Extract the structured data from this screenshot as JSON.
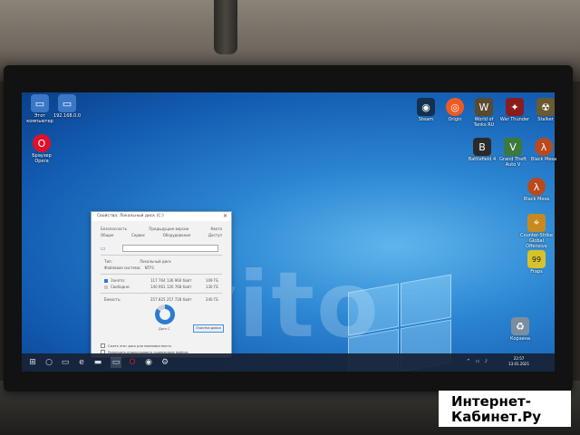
{
  "watermark": "Avito",
  "desktop_icons": [
    {
      "id": "this-pc",
      "label": "Этот компьютер",
      "color": "#3a77c4",
      "glyph": "▭"
    },
    {
      "id": "network",
      "label": "192.168.0.0",
      "color": "#3a77c4",
      "glyph": "▭"
    },
    {
      "id": "opera",
      "label": "Браузер Opera",
      "color": "#e0102a",
      "glyph": "O"
    },
    {
      "id": "steam",
      "label": "Steam",
      "color": "#14304f",
      "glyph": "◉"
    },
    {
      "id": "origin",
      "label": "Origin",
      "color": "#f05a22",
      "glyph": "◎"
    },
    {
      "id": "wot",
      "label": "World of Tanks RU",
      "color": "#5a4a2e",
      "glyph": "W"
    },
    {
      "id": "warthunder",
      "label": "War Thunder",
      "color": "#8a1c1c",
      "glyph": "✦"
    },
    {
      "id": "stalker",
      "label": "Stalker",
      "color": "#6a5a30",
      "glyph": "☢"
    },
    {
      "id": "battlefield",
      "label": "Battlefield 4",
      "color": "#2a2a2a",
      "glyph": "B"
    },
    {
      "id": "gta",
      "label": "Grand Theft Auto V",
      "color": "#3b7a3b",
      "glyph": "V"
    },
    {
      "id": "blackmesa1",
      "label": "Black Mesa",
      "color": "#b84a1e",
      "glyph": "λ"
    },
    {
      "id": "blackmesa2",
      "label": "Black Mesa",
      "color": "#b84a1e",
      "glyph": "λ"
    },
    {
      "id": "csgo",
      "label": "Counter-Strike Global Offensive",
      "color": "#c88a1e",
      "glyph": "⌖"
    },
    {
      "id": "fraps",
      "label": "Fraps",
      "color": "#d8c22a",
      "glyph": "99"
    },
    {
      "id": "recycle",
      "label": "Корзина",
      "color": "#7a8ea0",
      "glyph": "♻"
    }
  ],
  "dialog": {
    "title": "Свойства: Локальный диск (C:)",
    "close": "✕",
    "tabs_row1": [
      "Безопасность",
      "Предыдущие версии",
      "Квота"
    ],
    "tabs_row2": [
      "Общие",
      "Сервис",
      "Оборудование",
      "Доступ"
    ],
    "type_label": "Тип:",
    "type_value": "Локальный диск",
    "fs_label": "Файловая система:",
    "fs_value": "NTFS",
    "used_label": "Занято:",
    "used_bytes": "117 764 136 960 байт",
    "used_gb": "109 ГБ",
    "free_label": "Свободно:",
    "free_bytes": "140 061 120 768 байт",
    "free_gb": "130 ГБ",
    "capacity_label": "Ёмкость:",
    "capacity_bytes": "257 825 257 728 байт",
    "capacity_gb": "240 ГБ",
    "disk_label": "Диск C",
    "cleanup_label": "Очистка диска",
    "used_color": "#2b7bd6",
    "free_color": "#c8c8c8",
    "check1": "Сжать этот диск для экономии места",
    "check2": "Разрешить индексировать содержимое файлов"
  },
  "taskbar": {
    "start_icon": "windows-icon",
    "clock_time": "22:57",
    "clock_date": "13.01.2021"
  },
  "brand": {
    "line1": "Интернет-",
    "line2": "Кабинет.Ру"
  }
}
